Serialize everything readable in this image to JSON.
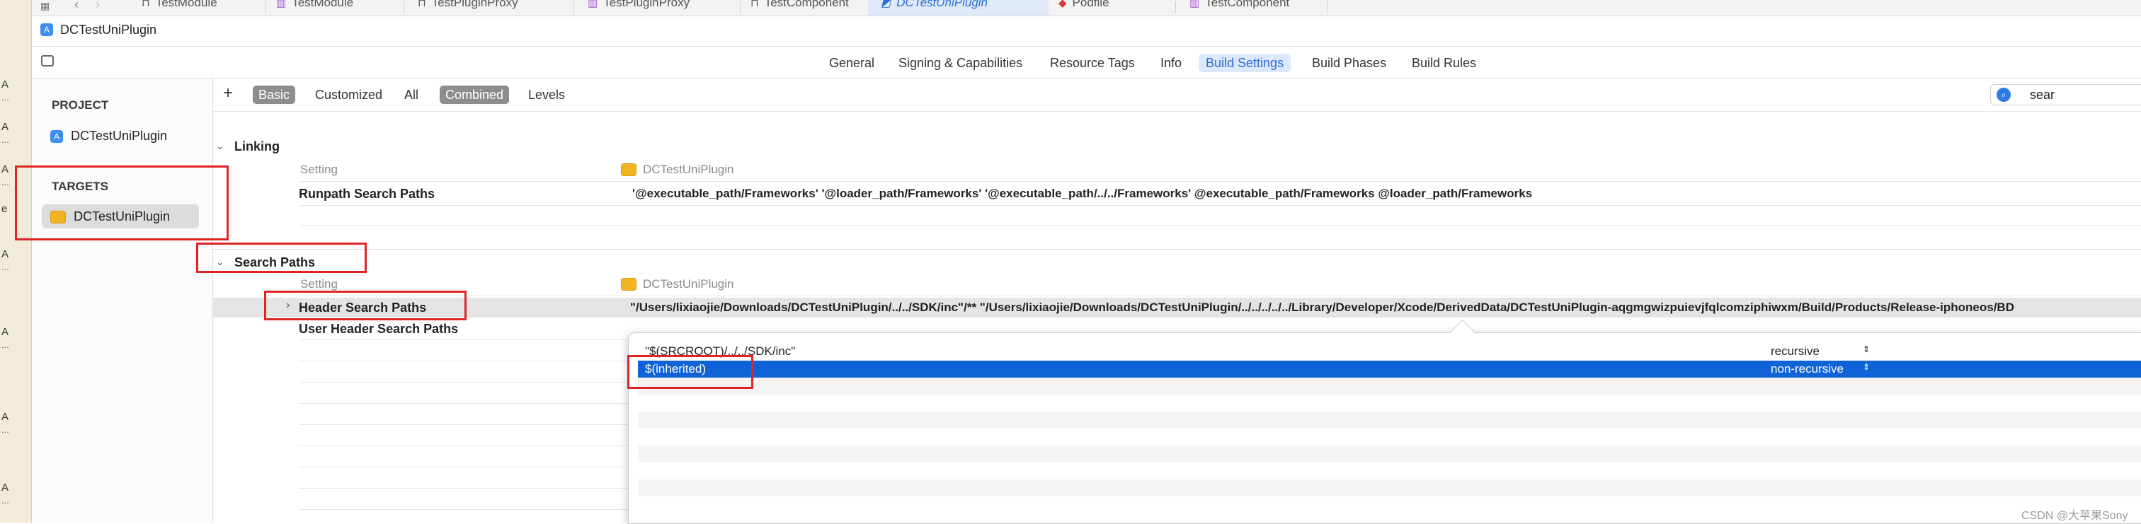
{
  "gutter": {
    "marks": [
      "A",
      "...",
      "A",
      "...",
      "A",
      "...",
      "e",
      "A",
      "...",
      "A",
      "...",
      "A",
      "...",
      "A",
      "..."
    ]
  },
  "tabs": [
    {
      "label": "TestModule",
      "icon": "target-icon"
    },
    {
      "label": "TestModule",
      "icon": "file-icon"
    },
    {
      "label": "TestPluginProxy",
      "icon": "target-icon"
    },
    {
      "label": "TestPluginProxy",
      "icon": "file-icon"
    },
    {
      "label": "TestComponent",
      "icon": "target-icon"
    },
    {
      "label": "DCTestUniPlugin",
      "icon": "app-icon",
      "active": true
    },
    {
      "label": "Podfile",
      "icon": "ruby-icon"
    },
    {
      "label": "TestComponent",
      "icon": "file-icon"
    }
  ],
  "breadcrumb": {
    "project": "DCTestUniPlugin"
  },
  "editor_tabs": [
    {
      "label": "General"
    },
    {
      "label": "Signing & Capabilities"
    },
    {
      "label": "Resource Tags"
    },
    {
      "label": "Info"
    },
    {
      "label": "Build Settings",
      "active": true
    },
    {
      "label": "Build Phases"
    },
    {
      "label": "Build Rules"
    }
  ],
  "sidebar": {
    "project_header": "PROJECT",
    "project_item": "DCTestUniPlugin",
    "targets_header": "TARGETS",
    "target_item": "DCTestUniPlugin"
  },
  "filter": {
    "add": "+",
    "basic": "Basic",
    "customized": "Customized",
    "all": "All",
    "combined": "Combined",
    "levels": "Levels",
    "search_value": "sear"
  },
  "linking": {
    "title": "Linking",
    "col_setting": "Setting",
    "col_target": "DCTestUniPlugin",
    "rows": [
      {
        "name": "Runpath Search Paths",
        "value": "'@executable_path/Frameworks' '@loader_path/Frameworks' '@executable_path/../../Frameworks' @executable_path/Frameworks @loader_path/Frameworks"
      }
    ]
  },
  "search_paths": {
    "title": "Search Paths",
    "col_setting": "Setting",
    "col_target": "DCTestUniPlugin",
    "header_search": {
      "name": "Header Search Paths",
      "value": "\"/Users/lixiaojie/Downloads/DCTestUniPlugin/../../SDK/inc\"/** \"/Users/lixiaojie/Downloads/DCTestUniPlugin/../../../../../Library/Developer/Xcode/DerivedData/DCTestUniPlugin-aqgmgwizpuievjfqlcomziphiwxm/Build/Products/Release-iphoneos/BD"
    },
    "user_header_search": {
      "name": "User Header Search Paths"
    }
  },
  "popover": {
    "rows": [
      {
        "path": "\"$(SRCROOT)/../../SDK/inc\"",
        "mode": "recursive"
      },
      {
        "path": "$(inherited)",
        "mode": "non-recursive",
        "selected": true
      }
    ]
  },
  "watermark": "CSDN @大苹果Sony"
}
